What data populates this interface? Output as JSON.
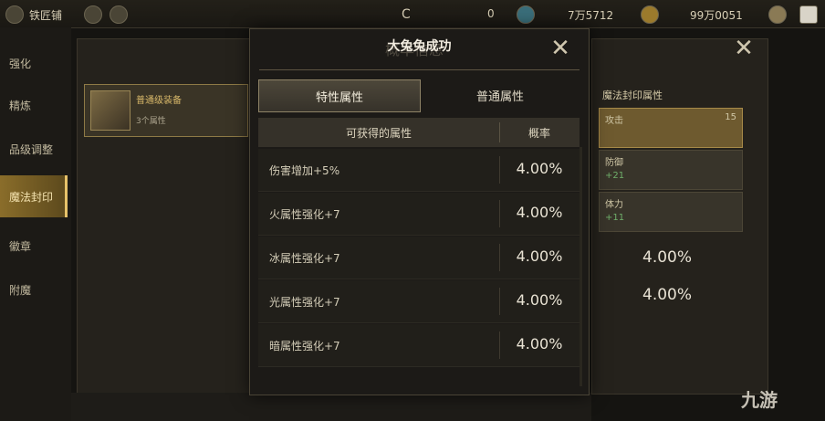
{
  "topbar": {
    "title": "铁匠铺",
    "gold": "7万5712",
    "currency2": "99万0051",
    "zero": "0"
  },
  "left_menu": [
    {
      "label": "强化",
      "active": false
    },
    {
      "label": "精炼",
      "active": false
    },
    {
      "label": "品级调整",
      "active": false
    },
    {
      "label": "魔法封印",
      "active": true
    },
    {
      "label": "徽章",
      "active": false
    },
    {
      "label": "附魔",
      "active": false
    }
  ],
  "item_card": {
    "name": "普通级装备",
    "sub": "3个属性"
  },
  "right_panel": {
    "header": "魔法封印属性",
    "stats": [
      {
        "name": "攻击",
        "value": "15"
      },
      {
        "name": "防御",
        "value": "+21"
      },
      {
        "name": "体力",
        "value": "+11"
      }
    ],
    "float_rates": [
      "4.00%",
      "4.00%"
    ]
  },
  "modal": {
    "title": "大兔兔成功",
    "title_ghost": "概率信息",
    "close_icon": "close-icon",
    "tabs": [
      {
        "label": "特性属性",
        "active": true
      },
      {
        "label": "普通属性",
        "active": false
      }
    ],
    "table": {
      "headers": [
        "可获得的属性",
        "概率"
      ],
      "rows": [
        {
          "name": "伤害增加+5%",
          "rate": "4.00%"
        },
        {
          "name": "火属性强化+7",
          "rate": "4.00%"
        },
        {
          "name": "冰属性强化+7",
          "rate": "4.00%"
        },
        {
          "name": "光属性强化+7",
          "rate": "4.00%"
        },
        {
          "name": "暗属性强化+7",
          "rate": "4.00%"
        }
      ]
    }
  },
  "watermark": "九游"
}
